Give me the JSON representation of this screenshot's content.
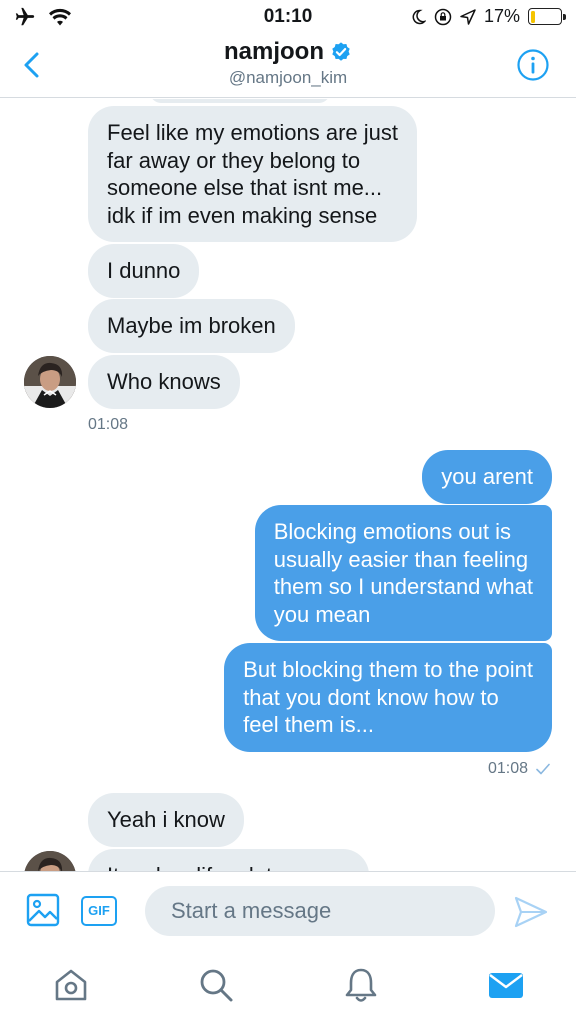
{
  "status_bar": {
    "time": "01:10",
    "battery_percent": "17%",
    "battery_level": 0.17,
    "icons": [
      "airplane-icon",
      "wifi-icon",
      "moon-icon",
      "rotation-lock-icon",
      "location-icon",
      "battery-icon"
    ]
  },
  "header": {
    "name": "namjoon",
    "handle": "@namjoon_kim",
    "verified": true
  },
  "messages": [
    {
      "direction": "in",
      "text": "Feel like my emotions are just\nfar away or they belong to\nsomeone else that isnt me...\nidk if im even making sense"
    },
    {
      "direction": "in",
      "text": "I dunno"
    },
    {
      "direction": "in",
      "text": "Maybe im broken"
    },
    {
      "direction": "in",
      "text": "Who knows"
    },
    {
      "direction": "in",
      "text": "01:08",
      "kind": "timestamp"
    },
    {
      "direction": "out",
      "text": "you arent"
    },
    {
      "direction": "out",
      "text": "Blocking emotions out is\nusually easier than feeling\nthem so I understand what\nyou mean"
    },
    {
      "direction": "out",
      "text": "But blocking them to the point\nthat you dont know how to\nfeel them is..."
    },
    {
      "direction": "out",
      "text": "01:08",
      "kind": "timestamp",
      "read": true
    },
    {
      "direction": "in",
      "text": "Yeah i know"
    },
    {
      "direction": "in",
      "text": "It makes life a lot more…"
    }
  ],
  "composer": {
    "gif_label": "GIF",
    "placeholder": "Start a message"
  },
  "tabs": [
    "home",
    "explore",
    "notifications",
    "messages"
  ],
  "colors": {
    "accent": "#1da1f2",
    "outgoing_bubble": "#4a9fe8",
    "incoming_bubble": "#e6ecf0",
    "muted_text": "#657786",
    "battery_low": "#f5c400"
  }
}
